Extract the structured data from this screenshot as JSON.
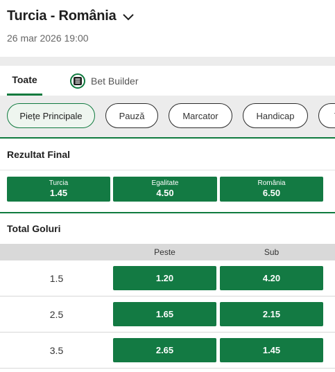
{
  "match": {
    "title": "Turcia - România",
    "datetime": "26 mar 2026 19:00"
  },
  "tabs": [
    {
      "label": "Toate"
    },
    {
      "label": "Bet Builder"
    }
  ],
  "chips": [
    {
      "label": "Piețe Principale"
    },
    {
      "label": "Pauză"
    },
    {
      "label": "Marcator"
    },
    {
      "label": "Handicap"
    },
    {
      "label": "T"
    }
  ],
  "result_market": {
    "title": "Rezultat Final",
    "outcomes": [
      {
        "label": "Turcia",
        "odds": "1.45"
      },
      {
        "label": "Egalitate",
        "odds": "4.50"
      },
      {
        "label": "România",
        "odds": "6.50"
      }
    ]
  },
  "goals_market": {
    "title": "Total Goluri",
    "headers": {
      "over": "Peste",
      "under": "Sub"
    },
    "rows": [
      {
        "line": "1.5",
        "over": "1.20",
        "under": "4.20"
      },
      {
        "line": "2.5",
        "over": "1.65",
        "under": "2.15"
      },
      {
        "line": "3.5",
        "over": "2.65",
        "under": "1.45"
      }
    ]
  },
  "colors": {
    "accent_green": "#0f7a3e",
    "odds_button": "#137a43",
    "background_gray": "#ececec"
  }
}
